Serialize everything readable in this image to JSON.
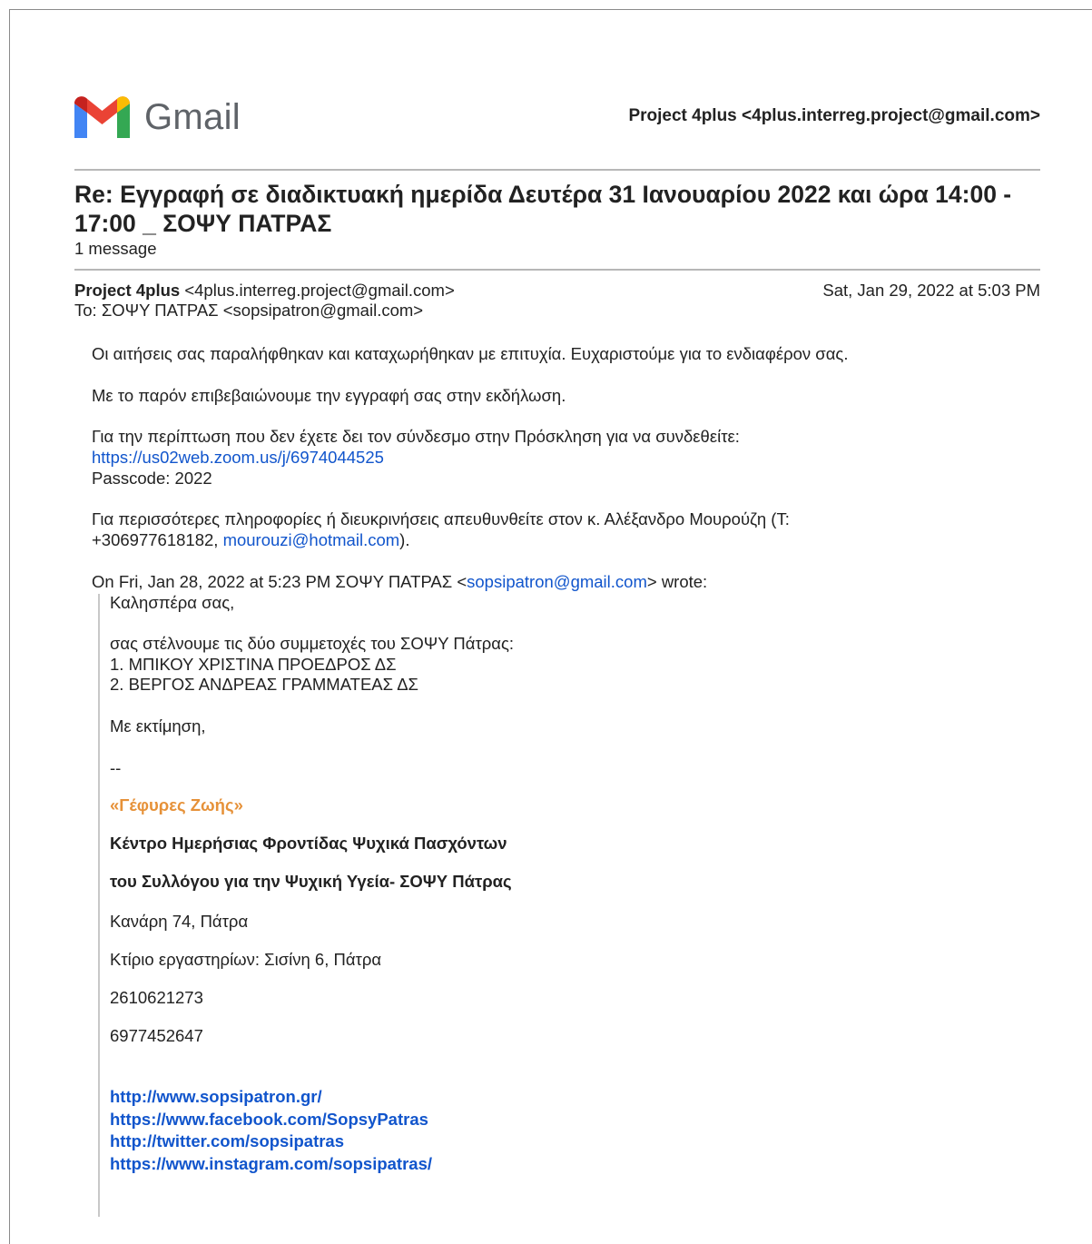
{
  "header": {
    "logo_text": "Gmail",
    "account": "Project 4plus <4plus.interreg.project@gmail.com>"
  },
  "thread": {
    "subject": "Re: Εγγραφή σε διαδικτυακή ημερίδα Δευτέρα 31 Ιανουαρίου 2022 και ώρα 14:00 - 17:00 _ ΣΟΨΥ ΠΑΤΡΑΣ",
    "message_count": "1 message"
  },
  "message": {
    "from_name": "Project 4plus",
    "from_email": "<4plus.interreg.project@gmail.com>",
    "date": "Sat, Jan 29, 2022 at 5:03 PM",
    "to": "To: ΣΟΨΥ ΠΑΤΡΑΣ <sopsipatron@gmail.com>",
    "body": {
      "p1": "Οι αιτήσεις σας παραλήφθηκαν και καταχωρήθηκαν με επιτυχία. Ευχαριστούμε για το ενδιαφέρον σας.",
      "p2": "Με το παρόν επιβεβαιώνουμε την εγγραφή σας στην εκδήλωση.",
      "p3": "Για την περίπτωση που δεν έχετε δει τον σύνδεσμο στην Πρόσκληση για να συνδεθείτε:",
      "zoom_link": "https://us02web.zoom.us/j/6974044525",
      "passcode": "Passcode: 2022",
      "p4_line1": "Για περισσότερες πληροφορίες ή διευκρινήσεις απευθυνθείτε στον κ. Αλέξανδρο Μουρούζη (Τ:",
      "p4_line2_prefix": "+306977618182, ",
      "p4_email": "mourouzi@hotmail.com",
      "p4_suffix": ").",
      "quote_header_prefix": "On Fri, Jan 28, 2022 at 5:23 PM ΣΟΨΥ ΠΑΤΡΑΣ <",
      "quote_header_email": "sopsipatron@gmail.com",
      "quote_header_suffix": "> wrote:"
    }
  },
  "quoted": {
    "greeting": "Καλησπέρα σας,",
    "intro": "σας στέλνουμε τις δύο συμμετοχές του ΣΟΨΥ Πάτρας:",
    "item1": "1. ΜΠΙΚΟΥ ΧΡΙΣΤΙΝΑ ΠΡΟΕΔΡΟΣ ΔΣ",
    "item2": "2. ΒΕΡΓΟΣ ΑΝΔΡΕΑΣ ΓΡΑΜΜΑΤΕΑΣ ΔΣ",
    "closing": "Με εκτίμηση,",
    "sig_sep": "--",
    "sig_brand": "«Γέφυρες Ζωής»",
    "sig_line1": "Κέντρο Ημερήσιας Φροντίδας Ψυχικά Πασχόντων",
    "sig_line2": "του Συλλόγου για την Ψυχική Υγεία- ΣΟΨΥ Πάτρας",
    "address1": "Κανάρη 74, Πάτρα",
    "address2": "Κτίριο εργαστηρίων: Σισίνη 6, Πάτρα",
    "phone1": "2610621273",
    "phone2": "6977452647",
    "links": [
      "http://www.sopsipatron.gr/",
      "https://www.facebook.com/SopsyPatras",
      "http://twitter.com/sopsipatras",
      "https://www.instagram.com/sopsipatras/"
    ]
  },
  "colors": {
    "link": "#1155cc",
    "brand_orange": "#e69138",
    "gmail_red": "#ea4335",
    "gmail_blue": "#4285f4",
    "gmail_green": "#34a853",
    "gmail_yellow": "#fbbc04"
  }
}
